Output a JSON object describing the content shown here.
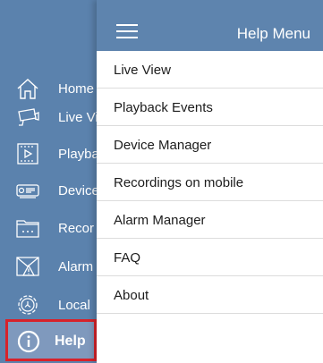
{
  "sidebar": {
    "items": [
      {
        "label": "Home",
        "icon": "home-icon"
      },
      {
        "label": "Live Vi",
        "icon": "camera-icon"
      },
      {
        "label": "Playba",
        "icon": "playback-film-icon"
      },
      {
        "label": "Device",
        "icon": "device-dvr-icon"
      },
      {
        "label": "Recor",
        "icon": "folder-icon"
      },
      {
        "label": "Alarm",
        "icon": "alarm-warning-icon"
      },
      {
        "label": "Local",
        "icon": "gear-icon"
      },
      {
        "label": "Help",
        "icon": "info-icon"
      }
    ],
    "active_color": "#7f99bd",
    "highlight_border": "#d8222a"
  },
  "drawer": {
    "title": "Help Menu",
    "menu_icon": "hamburger-icon",
    "items": [
      {
        "label": "Live View"
      },
      {
        "label": "Playback Events"
      },
      {
        "label": "Device Manager"
      },
      {
        "label": "Recordings on mobile"
      },
      {
        "label": "Alarm Manager"
      },
      {
        "label": "FAQ"
      },
      {
        "label": "About"
      }
    ]
  },
  "colors": {
    "header_blue": "#5e84ae",
    "sidebar_blue": "#5b82ad"
  }
}
